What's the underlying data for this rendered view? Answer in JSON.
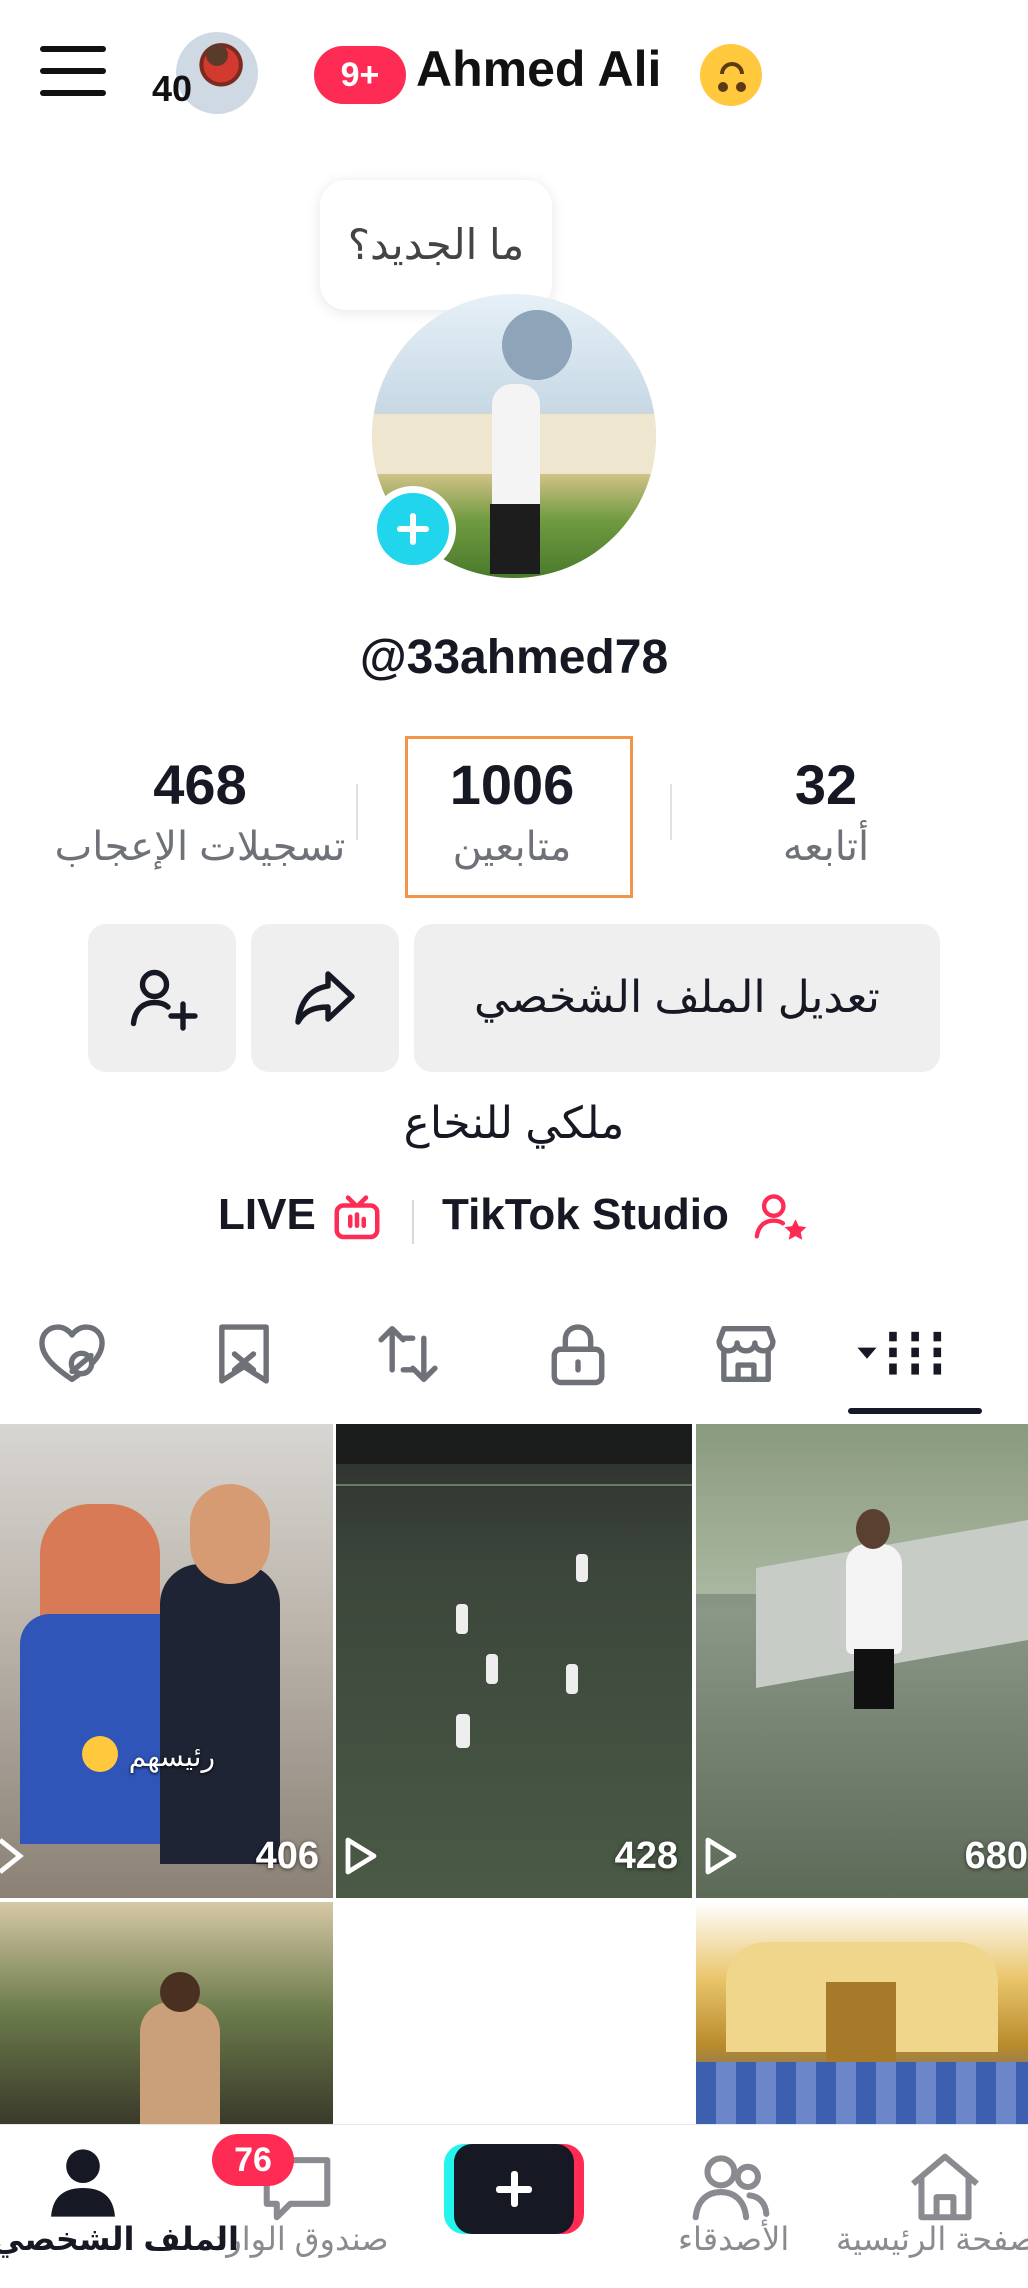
{
  "header": {
    "mini_avatar_count": "40",
    "notification_badge": "9+",
    "username": "Ahmed Ali"
  },
  "whats_new": "ما الجديد؟",
  "profile": {
    "handle": "@33ahmed78",
    "bio": "ملكي للنخاع"
  },
  "stats": {
    "following": {
      "value": "32",
      "label": "أتابعه"
    },
    "followers": {
      "value": "1006",
      "label": "متابعين"
    },
    "likes": {
      "value": "468",
      "label": "تسجيلات الإعجاب"
    }
  },
  "actions": {
    "edit_profile": "تعديل الملف الشخصي"
  },
  "links": {
    "live": "LIVE",
    "studio": "TikTok Studio"
  },
  "tabs": [
    "videos-icon",
    "shop-icon",
    "private-lock-icon",
    "repost-icon",
    "favorites-icon",
    "liked-icon"
  ],
  "videos": [
    {
      "views": "406",
      "caption": "رئيسهم"
    },
    {
      "views": "428"
    },
    {
      "views": "680"
    },
    {
      "views": ""
    },
    {
      "views": ""
    },
    {
      "views": ""
    }
  ],
  "bottom_nav": {
    "home": "صفحة الرئيسية",
    "friends": "الأصدقاء",
    "inbox": "صندوق الوارد",
    "inbox_badge": "76",
    "profile": "الملف الشخصي"
  },
  "colors": {
    "accent": "#fe2c55",
    "cyan": "#20d5ec",
    "highlight_box": "#f0954a"
  }
}
